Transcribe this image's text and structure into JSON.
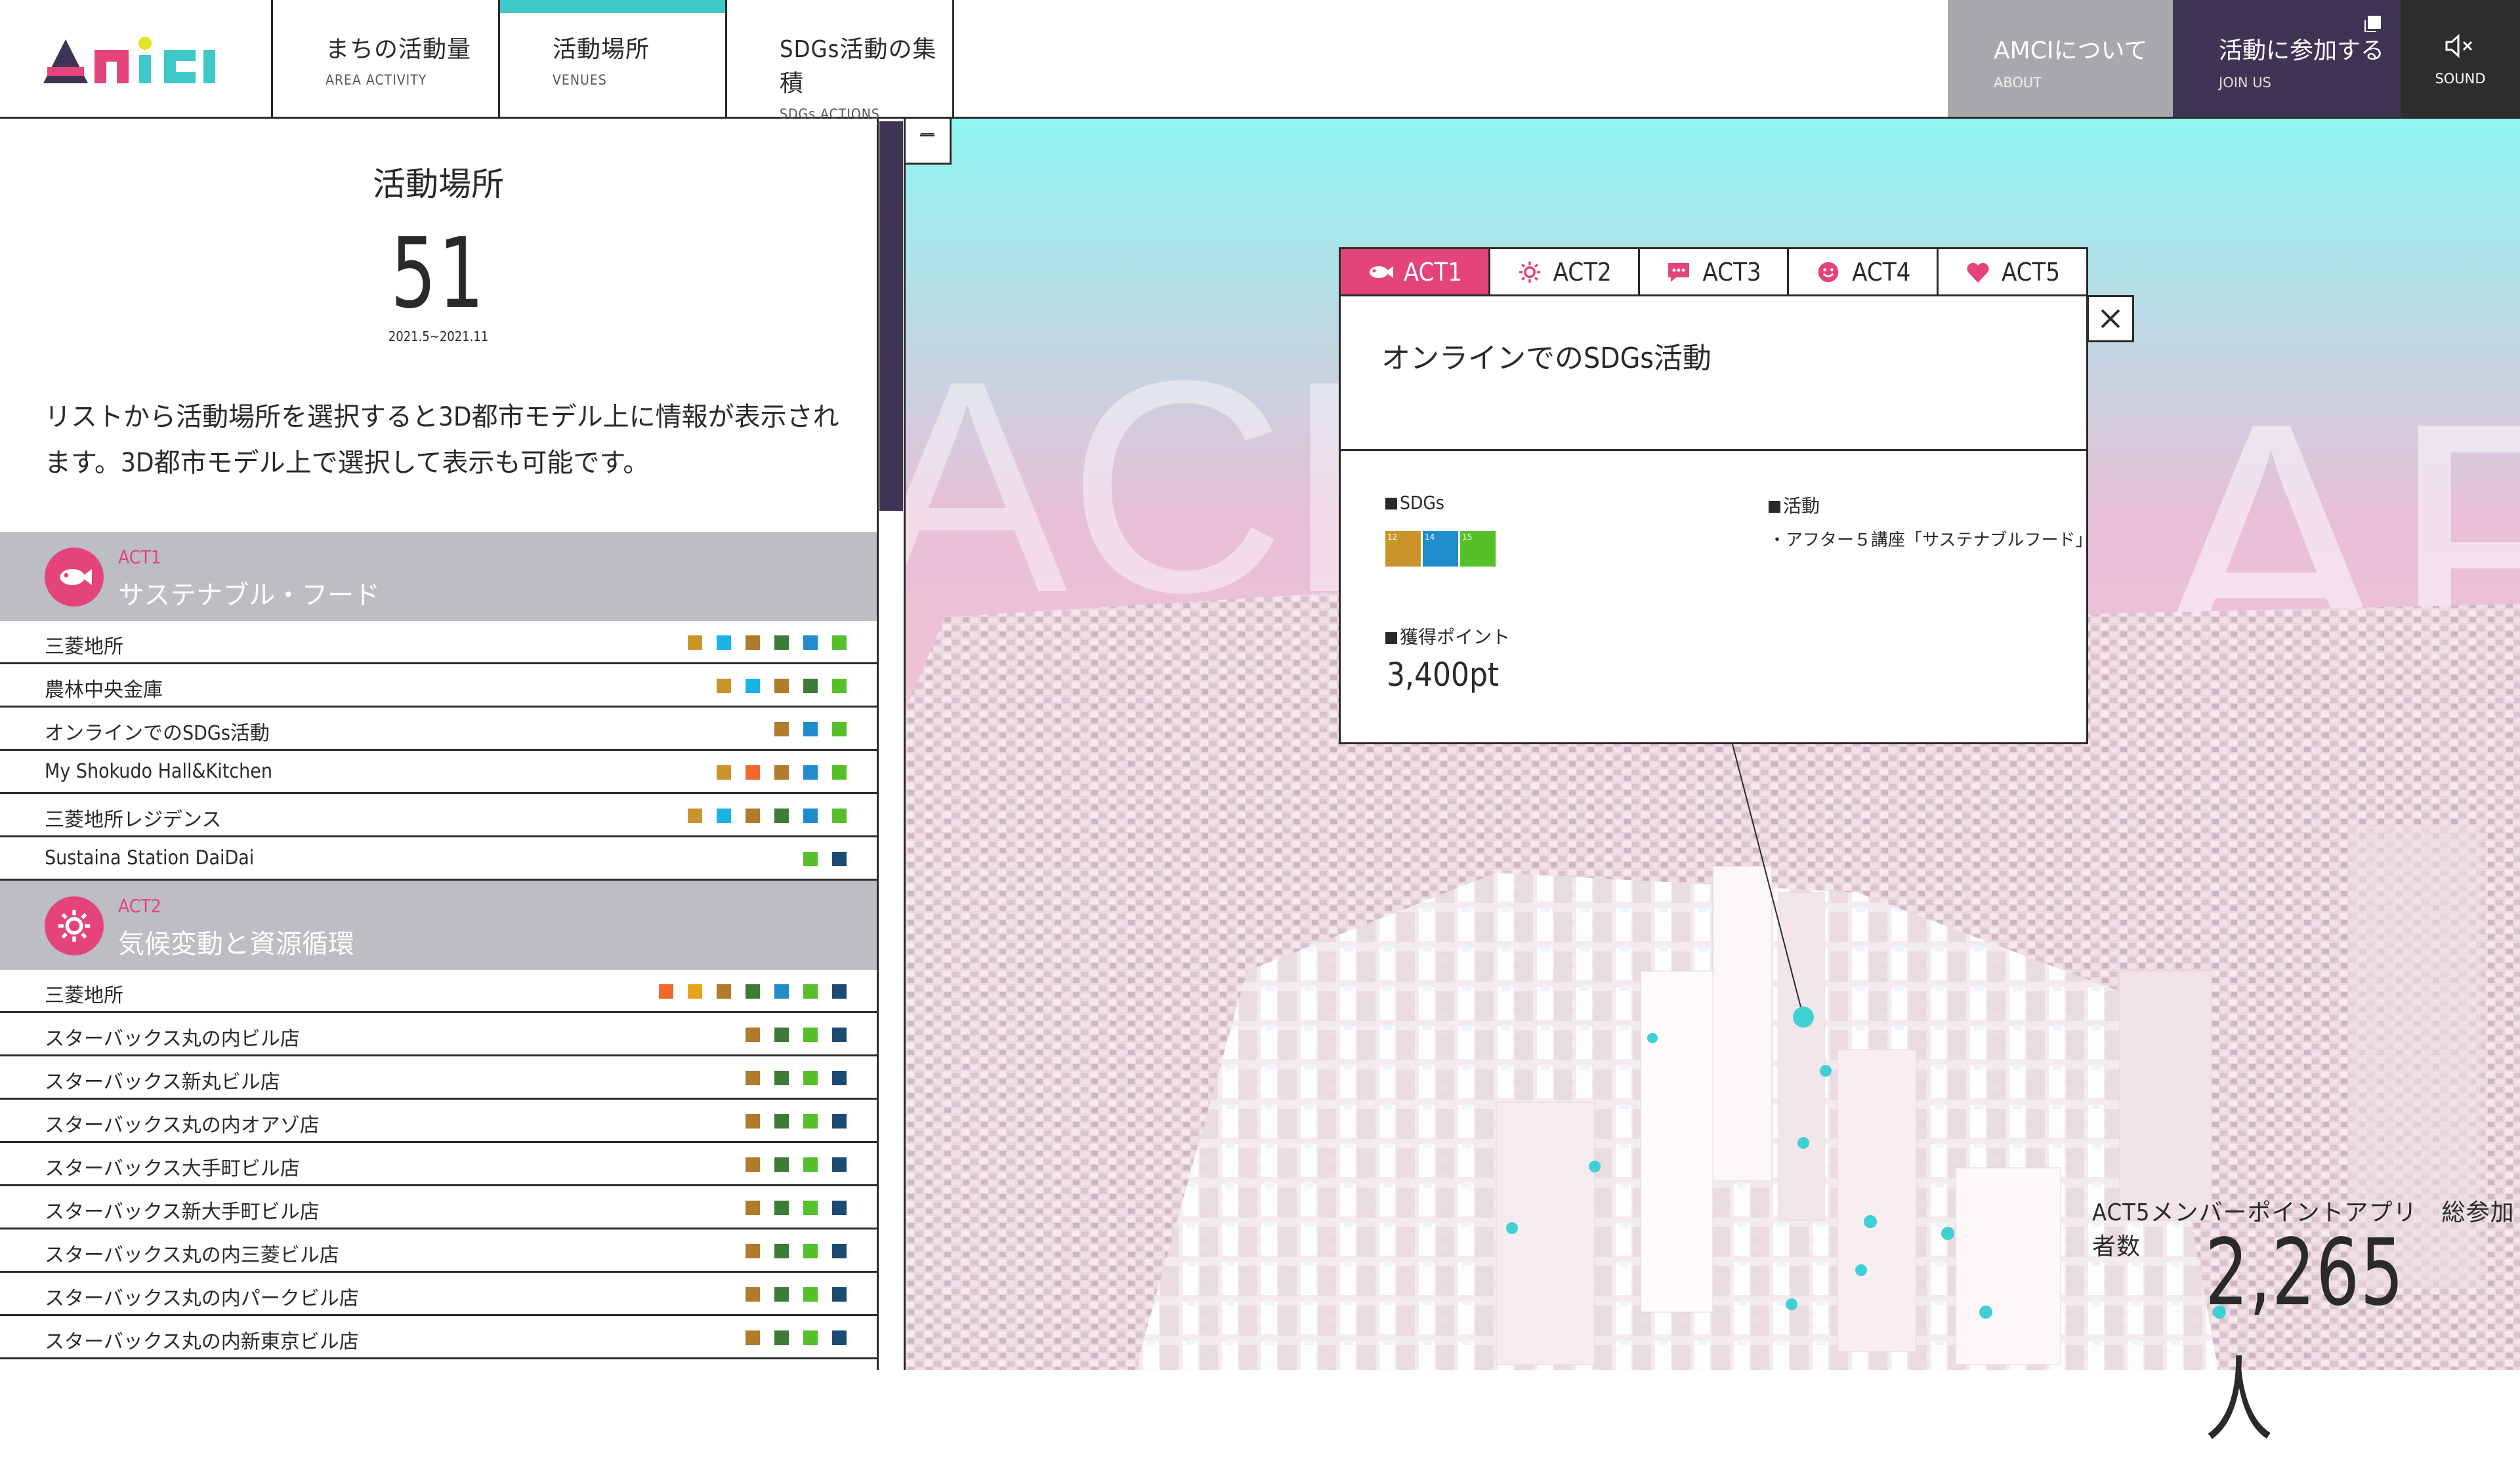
{
  "header": {
    "logo_text": "AMCI",
    "nav": [
      {
        "jp": "まちの活動量",
        "en": "AREA ACTIVITY"
      },
      {
        "jp": "活動場所",
        "en": "VENUES"
      },
      {
        "jp": "SDGs活動の集積",
        "en": "SDGs ACTIONS"
      }
    ],
    "about": {
      "jp": "AMCIについて",
      "en": "ABOUT"
    },
    "join": {
      "jp": "活動に参加する",
      "en": "JOIN US"
    },
    "sound": {
      "label": "SOUND"
    }
  },
  "panel": {
    "title": "活動場所",
    "count": "51",
    "date_range": "2021.5~2021.11",
    "description": "リストから活動場所を選択すると3D都市モデル上に情報が表示されます。3D都市モデル上で選択して表示も可能です。"
  },
  "colors": {
    "accent_pink": "#e4447b",
    "dark_purple": "#3e3453",
    "teal": "#3fc8c8",
    "gray": "#bcbec1",
    "sq_gold": "#c9952a",
    "sq_yellow": "#e8a31c",
    "sq_cyan": "#19b4e6",
    "sq_brown": "#b07b2b",
    "sq_green": "#3d7c36",
    "sq_blue": "#1f8ccb",
    "sq_lime": "#56c02b",
    "sq_navy": "#1c4a72",
    "sq_orange": "#f0682b"
  },
  "categories": [
    {
      "code": "ACT1",
      "title": "サステナブル・フード",
      "icon": "fish-icon",
      "venues": [
        {
          "name": "三菱地所",
          "squares": [
            "#c9952a",
            "#19b4e6",
            "#b07b2b",
            "#3d7c36",
            "#1f8ccb",
            "#56c02b"
          ]
        },
        {
          "name": "農林中央金庫",
          "squares": [
            "#c9952a",
            "#19b4e6",
            "#b07b2b",
            "#3d7c36",
            "#56c02b"
          ]
        },
        {
          "name": "オンラインでのSDGs活動",
          "squares": [
            "#b07b2b",
            "#1f8ccb",
            "#56c02b"
          ]
        },
        {
          "name": "My Shokudo Hall&Kitchen",
          "squares": [
            "#c9952a",
            "#f0682b",
            "#b07b2b",
            "#1f8ccb",
            "#56c02b"
          ]
        },
        {
          "name": "三菱地所レジデンス",
          "squares": [
            "#c9952a",
            "#19b4e6",
            "#b07b2b",
            "#3d7c36",
            "#1f8ccb",
            "#56c02b"
          ]
        },
        {
          "name": "Sustaina Station DaiDai",
          "squares": [
            "#56c02b",
            "#1c4a72"
          ]
        }
      ]
    },
    {
      "code": "ACT2",
      "title": "気候変動と資源循環",
      "icon": "sun-icon",
      "venues": [
        {
          "name": "三菱地所",
          "squares": [
            "#f0682b",
            "#e8a31c",
            "#b07b2b",
            "#3d7c36",
            "#1f8ccb",
            "#56c02b",
            "#1c4a72"
          ]
        },
        {
          "name": "スターバックス丸の内ビル店",
          "squares": [
            "#b07b2b",
            "#3d7c36",
            "#56c02b",
            "#1c4a72"
          ]
        },
        {
          "name": "スターバックス新丸ビル店",
          "squares": [
            "#b07b2b",
            "#3d7c36",
            "#56c02b",
            "#1c4a72"
          ]
        },
        {
          "name": "スターバックス丸の内オアゾ店",
          "squares": [
            "#b07b2b",
            "#3d7c36",
            "#56c02b",
            "#1c4a72"
          ]
        },
        {
          "name": "スターバックス大手町ビル店",
          "squares": [
            "#b07b2b",
            "#3d7c36",
            "#56c02b",
            "#1c4a72"
          ]
        },
        {
          "name": "スターバックス新大手町ビル店",
          "squares": [
            "#b07b2b",
            "#3d7c36",
            "#56c02b",
            "#1c4a72"
          ]
        },
        {
          "name": "スターバックス丸の内三菱ビル店",
          "squares": [
            "#b07b2b",
            "#3d7c36",
            "#56c02b",
            "#1c4a72"
          ]
        },
        {
          "name": "スターバックス丸の内パークビル店",
          "squares": [
            "#b07b2b",
            "#3d7c36",
            "#56c02b",
            "#1c4a72"
          ]
        },
        {
          "name": "スターバックス丸の内新東京ビル店",
          "squares": [
            "#b07b2b",
            "#3d7c36",
            "#56c02b",
            "#1c4a72"
          ]
        }
      ]
    }
  ],
  "map": {
    "bg_text_left": "ACH",
    "bg_text_right": "AR"
  },
  "popup": {
    "tabs": [
      {
        "label": "ACT1",
        "icon": "fish-icon",
        "active": true
      },
      {
        "label": "ACT2",
        "icon": "sun-icon",
        "active": false
      },
      {
        "label": "ACT3",
        "icon": "speech-bubble-icon",
        "active": false
      },
      {
        "label": "ACT4",
        "icon": "smile-icon",
        "active": false
      },
      {
        "label": "ACT5",
        "icon": "heart-icon",
        "active": false
      }
    ],
    "title": "オンラインでのSDGs活動",
    "sdgs_label": "SDGs",
    "sdg_badges": [
      {
        "number": "12",
        "color": "#c9952a"
      },
      {
        "number": "14",
        "color": "#1f8ccb"
      },
      {
        "number": "15",
        "color": "#56c02b"
      }
    ],
    "activity_label": "活動",
    "activity_value": "・アフター５講座「サステナブルフード」",
    "points_label": "獲得ポイント",
    "points_value": "3,400pt"
  },
  "participants": {
    "label": "ACT5メンバーポイントアプリ　総参加者数",
    "count": "2,265人"
  }
}
